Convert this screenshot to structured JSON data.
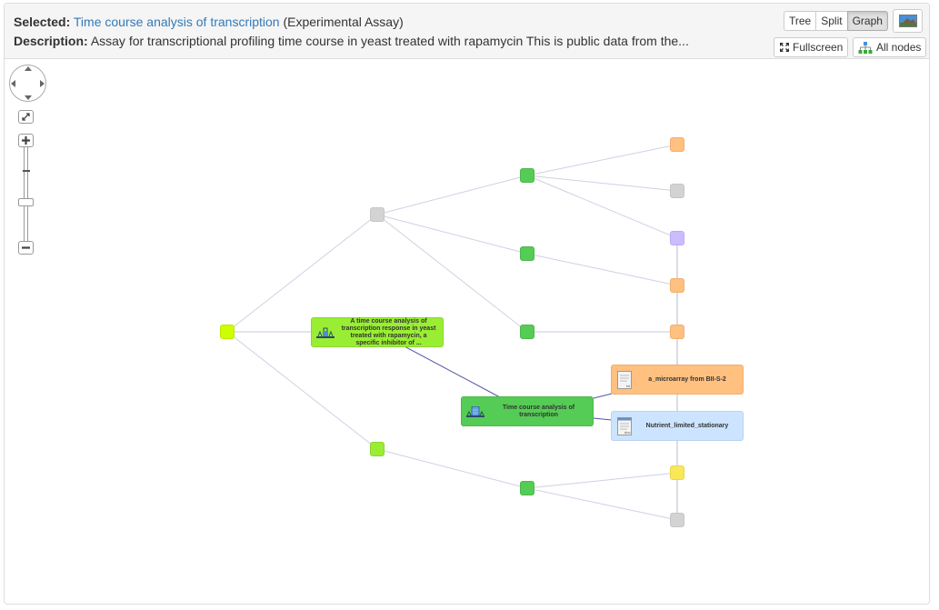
{
  "header": {
    "selected_label": "Selected:",
    "selected_link": "Time course analysis of transcription",
    "selected_type": "(Experimental Assay)",
    "description_label": "Description:",
    "description_text": "Assay for transcriptional profiling time course in yeast treated with rapamycin This is public data from the..."
  },
  "view_toggle": {
    "options": [
      "Tree",
      "Split",
      "Graph"
    ],
    "active": "Graph"
  },
  "toolbar": {
    "image_button_icon": "image-icon",
    "fullscreen_label": "Fullscreen",
    "all_nodes_label": "All nodes"
  },
  "graph_controls": {
    "pan_icon": "pan-control-icon",
    "fit_icon": "fit-to-view-icon",
    "zoom_in_icon": "zoom-in-icon",
    "zoom_out_icon": "zoom-out-icon",
    "zoom_level_fraction": 0.4
  },
  "colors": {
    "study": "#ccff00",
    "investigation_node": "#99ee33",
    "assay": "#55cc55",
    "data_file": "#ffc080",
    "sample": "#cce4ff",
    "gray_node": "#d3d3d3",
    "purple_node": "#ccbbff",
    "yellow_node": "#f8e858",
    "edge": "#c8c8dd",
    "selected_edge": "#5555aa"
  },
  "graph": {
    "cards": {
      "study_card": "A time course analysis of transcription response in yeast treated with rapamycin, a specific inhibitor of ...",
      "assay_card": "Time course analysis of transcription",
      "data_file_card": "a_microarray from BII-S-2",
      "sample_card": "Nutrient_limited_stationary"
    }
  }
}
